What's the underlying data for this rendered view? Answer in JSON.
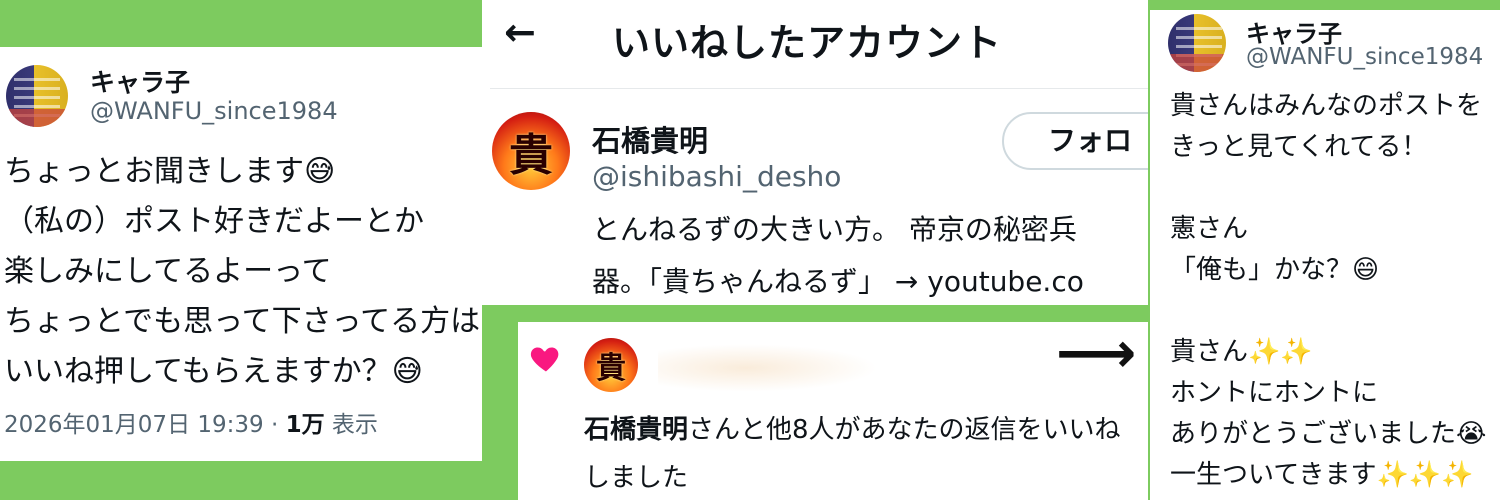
{
  "left_tweet": {
    "display_name": "キャラ子",
    "handle": "@WANFU_since1984",
    "lines": [
      "ちょっとお聞きします😅",
      "（私の）ポスト好きだよーとか",
      "楽しみにしてるよーって",
      "ちょっとでも思って下さってる方は",
      "いいね押してもらえますか？😅"
    ],
    "timestamp": "2026年01月07日 19:39 · ",
    "views_count": "1万",
    "views_label": " 表示"
  },
  "likes_page": {
    "back_icon": "←",
    "title": "いいねしたアカウント",
    "account": {
      "avatar_text": "貴",
      "display_name": "石橋貴明",
      "handle": "@ishibashi_desho",
      "follow_label": "フォロ",
      "bio_lines": [
        "とんねるずの大きい方。 帝京の秘密兵",
        "器。「貴ちゃんねるず」 → youtube.co"
      ]
    }
  },
  "notification": {
    "heart_color": "#f91880",
    "avatar_text": "貴",
    "name_bold": "石橋貴明",
    "text_line1_rest": "さんと他8人があなたの返信をいいね",
    "text_line2": "しました"
  },
  "arrow_icon": "⟶",
  "right_tweet": {
    "display_name": "キャラ子",
    "handle": "@WANFU_since1984",
    "lines": [
      "貴さんはみんなのポストを",
      "きっと見てくれてる！",
      "",
      "憲さん",
      "「俺も」かな？😄",
      "",
      "貴さん✨✨",
      "ホントにホントに",
      "ありがとうございました😭",
      "一生ついてきます✨✨✨"
    ]
  },
  "colors": {
    "background": "#7dcb5f",
    "handle_gray": "#536471",
    "heart_pink": "#f91880"
  }
}
